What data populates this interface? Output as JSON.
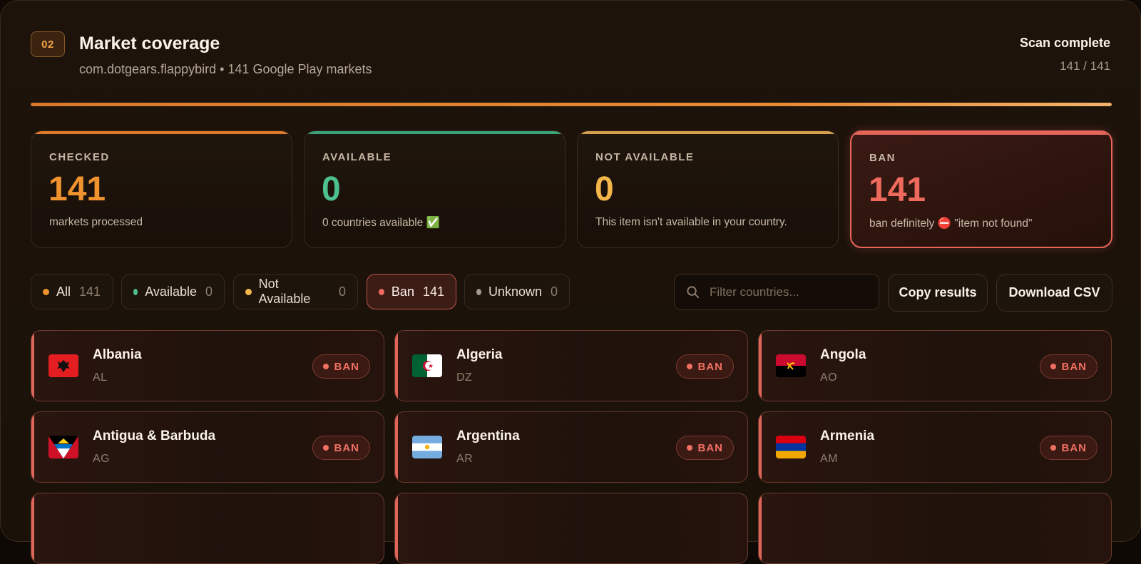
{
  "header": {
    "step": "02",
    "title": "Market coverage",
    "subtitle": "com.dotgears.flappybird • 141 Google Play markets",
    "status": "Scan complete",
    "status_count": "141 / 141",
    "progress_fraction": 1.0
  },
  "stats": [
    {
      "label": "CHECKED",
      "value": "141",
      "desc": "markets processed",
      "color": "#f0932e",
      "accent": "#e07a2a"
    },
    {
      "label": "AVAILABLE",
      "value": "0",
      "desc": "0 countries available ✅",
      "color": "#4ec08f",
      "accent": "#3aa37a"
    },
    {
      "label": "NOT AVAILABLE",
      "value": "0",
      "desc": "This item isn't available in your country.",
      "color": "#f2b64a",
      "accent": "#d7a04c"
    },
    {
      "label": "BAN",
      "value": "141",
      "desc": "ban definitely ⛔ \"item not found\"",
      "color": "#ee6a5d",
      "accent": "#e8655a",
      "active": true
    }
  ],
  "filters": [
    {
      "label": "All",
      "count": "141",
      "dot": "#f0932e"
    },
    {
      "label": "Available",
      "count": "0",
      "dot": "#4ec08f"
    },
    {
      "label": "Not Available",
      "count": "0",
      "dot": "#f2b64a"
    },
    {
      "label": "Ban",
      "count": "141",
      "dot": "#ee6a5d",
      "active": true
    },
    {
      "label": "Unknown",
      "count": "0",
      "dot": "#a59a8e"
    }
  ],
  "search": {
    "placeholder": "Filter countries..."
  },
  "actions": {
    "copy": "Copy results",
    "download": "Download CSV"
  },
  "countries": [
    {
      "name": "Albania",
      "code": "AL",
      "status": "BAN",
      "flag": "albania-flag"
    },
    {
      "name": "Algeria",
      "code": "DZ",
      "status": "BAN",
      "flag": "algeria-flag"
    },
    {
      "name": "Angola",
      "code": "AO",
      "status": "BAN",
      "flag": "angola-flag"
    },
    {
      "name": "Antigua & Barbuda",
      "code": "AG",
      "status": "BAN",
      "flag": "antigua-flag"
    },
    {
      "name": "Argentina",
      "code": "AR",
      "status": "BAN",
      "flag": "argentina-flag"
    },
    {
      "name": "Armenia",
      "code": "AM",
      "status": "BAN",
      "flag": "armenia-flag"
    }
  ]
}
